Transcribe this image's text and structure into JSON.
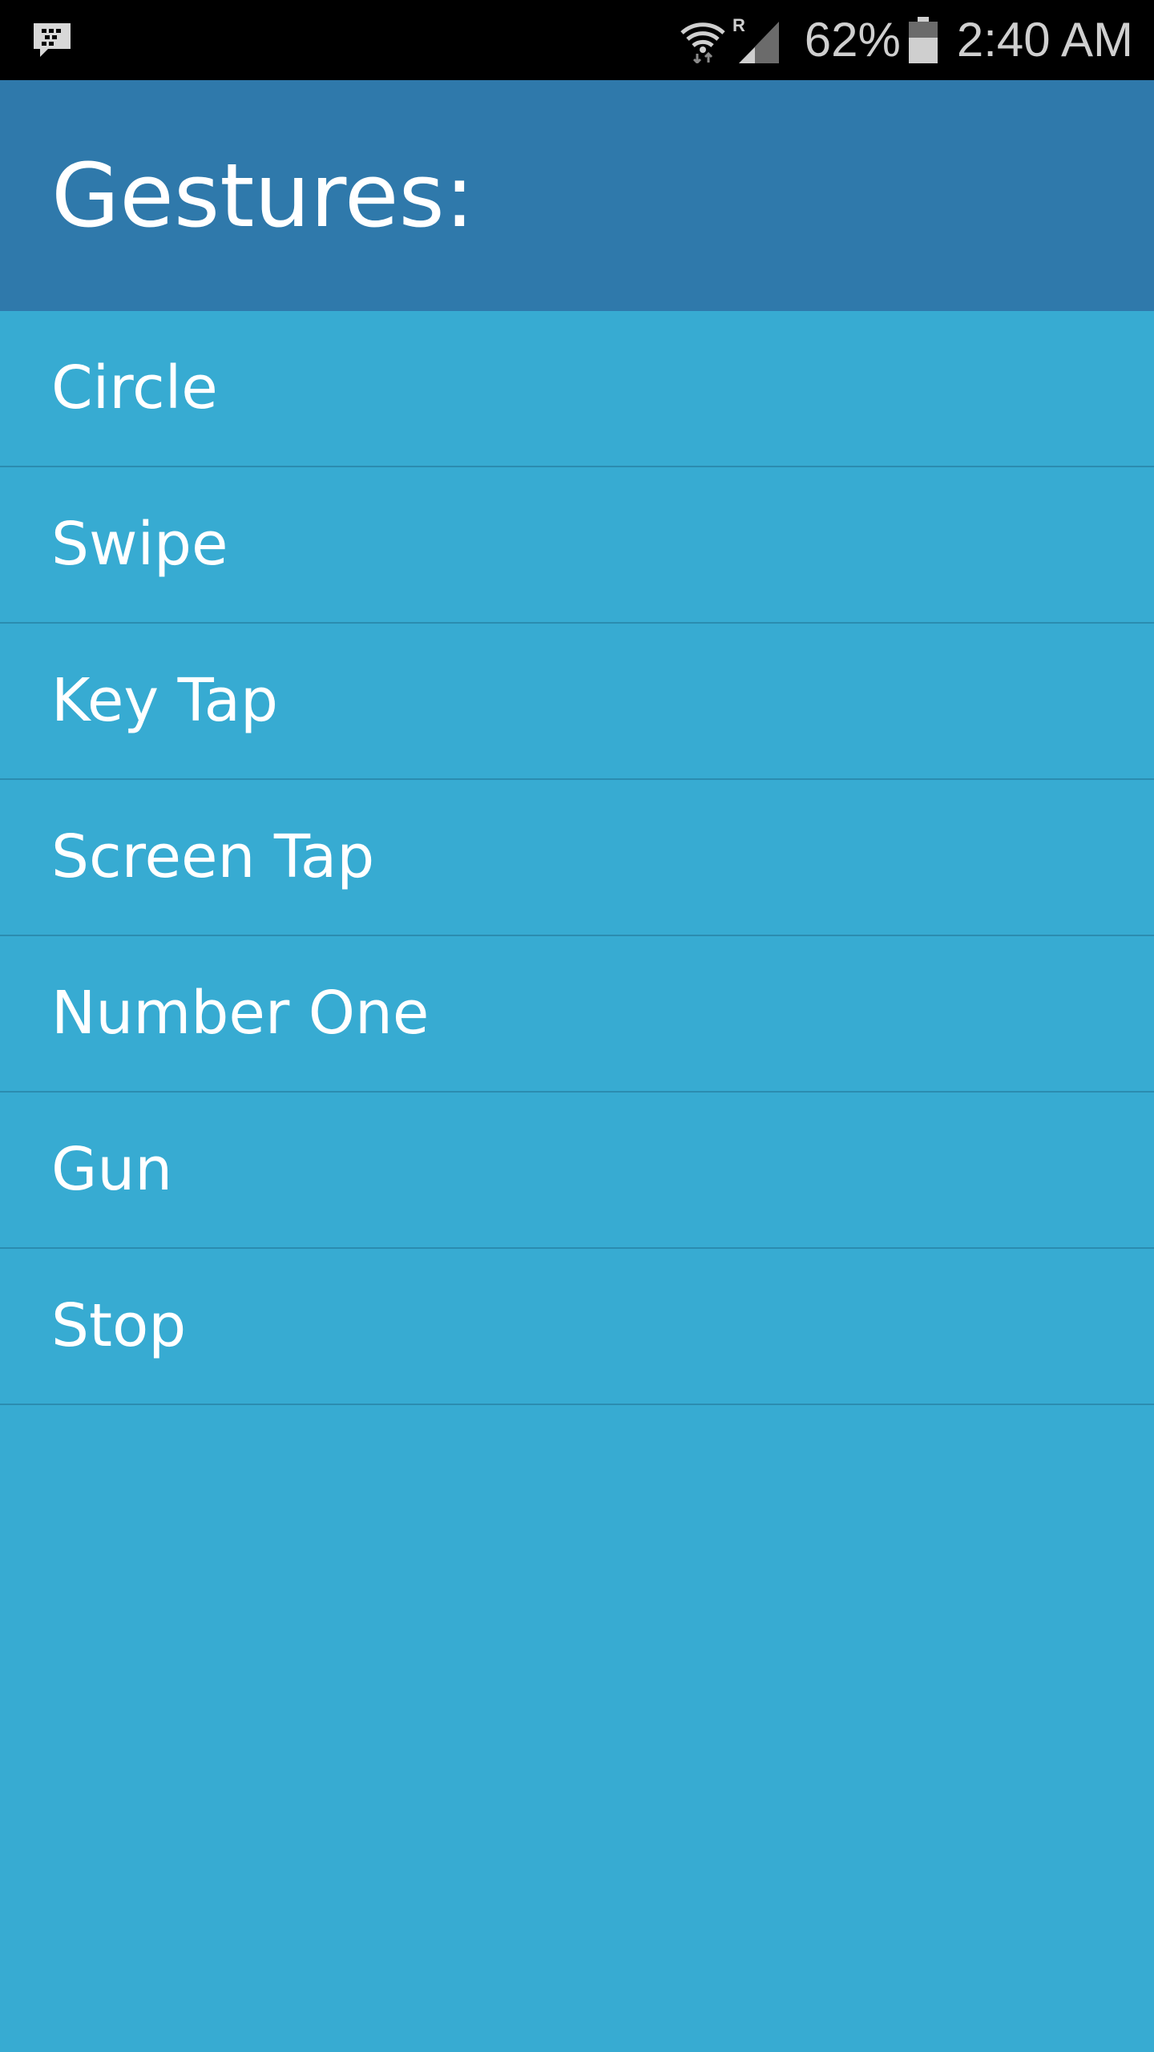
{
  "status_bar": {
    "battery_percent": "62%",
    "battery_level": 0.62,
    "time": "2:40 AM",
    "network_roaming": "R",
    "left_icon": "bbm-notification-icon",
    "icons": [
      "wifi-icon",
      "signal-icon",
      "battery-icon"
    ]
  },
  "header": {
    "title": "Gestures:",
    "background": "#2f79ab"
  },
  "gestures": [
    {
      "label": "Circle"
    },
    {
      "label": "Swipe"
    },
    {
      "label": "Key Tap"
    },
    {
      "label": "Screen Tap"
    },
    {
      "label": "Number One"
    },
    {
      "label": "Gun"
    },
    {
      "label": "Stop"
    }
  ],
  "colors": {
    "list_background": "#37abd2",
    "divider": "#2b8cb0",
    "text": "#ffffff"
  }
}
